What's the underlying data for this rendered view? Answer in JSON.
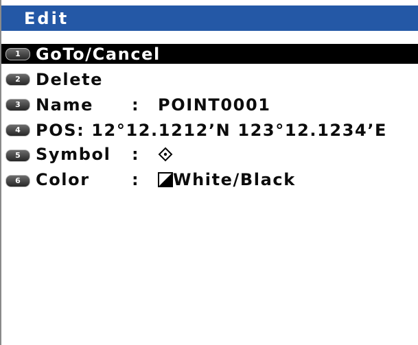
{
  "header": {
    "title": "Edit"
  },
  "menu": [
    {
      "number": "1",
      "label": "GoTo/Cancel",
      "selected": true
    },
    {
      "number": "2",
      "label": "Delete"
    },
    {
      "number": "3",
      "label": "Name",
      "separator": ":",
      "value": "POINT0001"
    },
    {
      "number": "4",
      "label": "POS:",
      "value": "12°12.1212’N 123°12.1234’E"
    },
    {
      "number": "5",
      "label": "Symbol",
      "separator": ":",
      "icon": "diamond-dot-icon"
    },
    {
      "number": "6",
      "label": "Color",
      "separator": ":",
      "icon": "black-white-swatch-icon",
      "value": "White/Black"
    }
  ],
  "colors": {
    "title_bar": "#2458a6",
    "selection": "#000000",
    "text": "#0c0c0c",
    "background": "#ffffff"
  }
}
